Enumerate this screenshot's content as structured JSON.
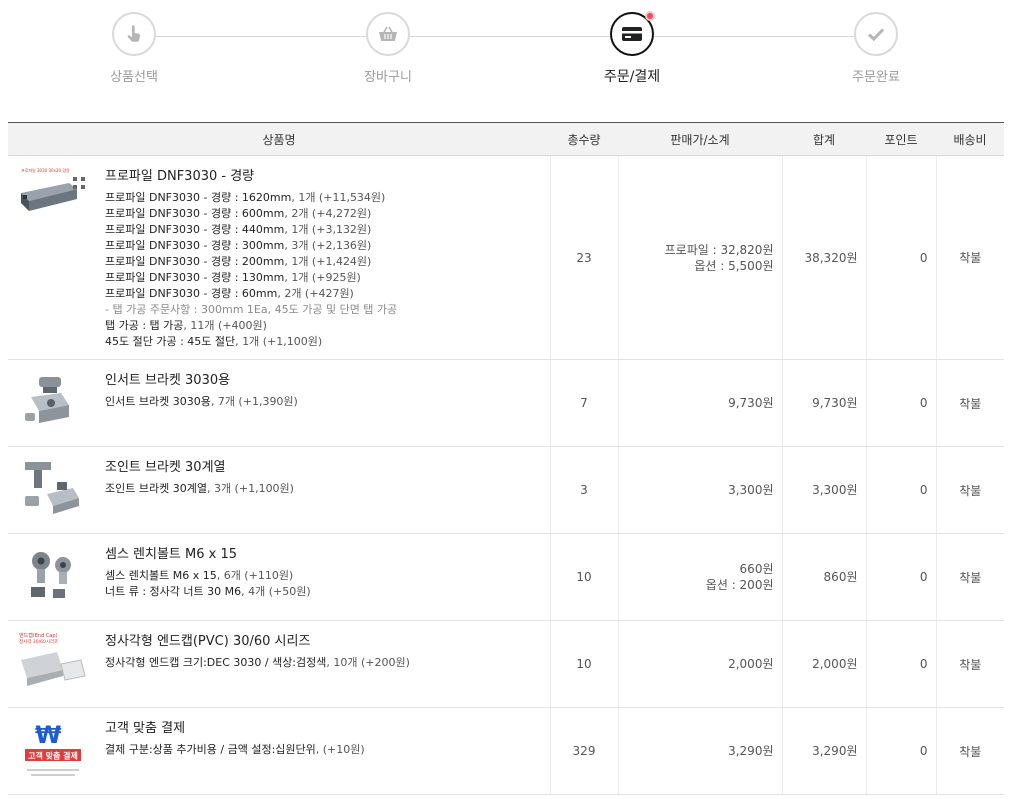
{
  "steps": [
    {
      "label": "상품선택",
      "icon": "hand-pointer-icon",
      "active": false
    },
    {
      "label": "장바구니",
      "icon": "basket-icon",
      "active": false
    },
    {
      "label": "주문/결제",
      "icon": "credit-card-icon",
      "active": true
    },
    {
      "label": "주문완료",
      "icon": "check-icon",
      "active": false
    }
  ],
  "table": {
    "headers": [
      "상품명",
      "총수량",
      "판매가/소계",
      "합계",
      "포인트",
      "배송비"
    ],
    "rows": [
      {
        "name": "프로파일 DNF3030 - 경량",
        "thumb": "profile-dnf3030-image",
        "options": [
          {
            "label": "프로파일 DNF3030 - 경량 : 1620mm",
            "detail": ", 1개 (+11,534원)"
          },
          {
            "label": "프로파일 DNF3030 - 경량 : 600mm",
            "detail": ", 2개 (+4,272원)"
          },
          {
            "label": "프로파일 DNF3030 - 경량 : 440mm",
            "detail": ", 1개 (+3,132원)"
          },
          {
            "label": "프로파일 DNF3030 - 경량 : 300mm",
            "detail": ", 3개 (+2,136원)"
          },
          {
            "label": "프로파일 DNF3030 - 경량 : 200mm",
            "detail": ", 1개 (+1,424원)"
          },
          {
            "label": "프로파일 DNF3030 - 경량 : 130mm",
            "detail": ", 1개 (+925원)"
          },
          {
            "label": "프로파일 DNF3030 - 경량 : 60mm",
            "detail": ", 2개 (+427원)"
          }
        ],
        "note": "- 탭 가공 주문사항 : 300mm 1Ea, 45도 가공 및 단면 탭 가공",
        "extra_options": [
          {
            "label": "탭 가공 : 탭 가공",
            "detail": ", 11개 (+400원)"
          },
          {
            "label": "45도 절단 가공 : 45도 절단",
            "detail": ", 1개 (+1,100원)"
          }
        ],
        "qty": "23",
        "price_lines": [
          "프로파일 : 32,820원",
          "옵션 : 5,500원"
        ],
        "total": "38,320원",
        "points": "0",
        "shipping": "착불"
      },
      {
        "name": "인서트 브라켓 3030용",
        "thumb": "insert-bracket-image",
        "options": [
          {
            "label": "인서트 브라켓 3030용",
            "detail": ", 7개 (+1,390원)"
          }
        ],
        "qty": "7",
        "price_lines": [
          "9,730원"
        ],
        "total": "9,730원",
        "points": "0",
        "shipping": "착불"
      },
      {
        "name": "조인트 브라켓 30계열",
        "thumb": "joint-bracket-image",
        "options": [
          {
            "label": "조인트 브라켓 30계열",
            "detail": ", 3개 (+1,100원)"
          }
        ],
        "qty": "3",
        "price_lines": [
          "3,300원"
        ],
        "total": "3,300원",
        "points": "0",
        "shipping": "착불"
      },
      {
        "name": "셈스 렌치볼트 M6 x 15",
        "thumb": "wrench-bolt-image",
        "options": [
          {
            "label": "셈스 렌치볼트 M6 x 15",
            "detail": ", 6개 (+110원)"
          },
          {
            "label": "너트 류 : 정사각 너트 30 M6",
            "detail": ", 4개 (+50원)"
          }
        ],
        "qty": "10",
        "price_lines": [
          "660원",
          "옵션 : 200원"
        ],
        "total": "860원",
        "points": "0",
        "shipping": "착불"
      },
      {
        "name": "정사각형 엔드캡(PVC) 30/60 시리즈",
        "thumb": "end-cap-image",
        "options": [
          {
            "label": "정사각형 엔드캡 크기:DEC 3030 / 색상:검정색",
            "detail": ", 10개 (+200원)"
          }
        ],
        "qty": "10",
        "price_lines": [
          "2,000원"
        ],
        "total": "2,000원",
        "points": "0",
        "shipping": "착불"
      },
      {
        "name": "고객 맞춤 결제",
        "thumb": "custom-payment-image",
        "options": [
          {
            "label": "결제 구분:상품 추가비용 / 금액 설정:십원단위",
            "detail": ", (+10원)"
          }
        ],
        "qty": "329",
        "price_lines": [
          "3,290원"
        ],
        "total": "3,290원",
        "points": "0",
        "shipping": "착불"
      }
    ]
  },
  "thumb_texts": {
    "profile": "프로파일 3030 30x30 경량",
    "endcap_line1": "앤드캡(End Cap)",
    "endcap_line2": "정사각 30/60시리즈",
    "custom_line1": "고객 맞춤 결제"
  },
  "colors": {
    "accent": "#e8505b",
    "active_border": "#111111",
    "inactive_border": "#d9d9d9"
  }
}
